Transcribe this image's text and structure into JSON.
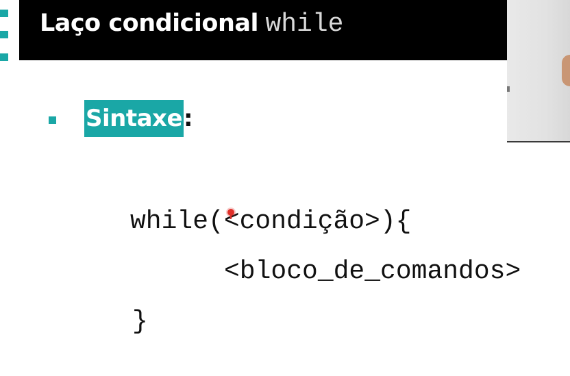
{
  "slide": {
    "title_main": "Laço condicional",
    "title_code": "while",
    "bullet_label": "Sintaxe",
    "bullet_suffix": ":",
    "code_lines": [
      "while(<condição>){",
      "<bloco_de_comandos>",
      "}"
    ]
  },
  "colors": {
    "accent": "#1aa7a6",
    "title_bar": "#000000",
    "pointer": "#e0302a"
  },
  "icons": {
    "pointer": "laser-pointer-icon",
    "bullet": "square-bullet-icon"
  }
}
